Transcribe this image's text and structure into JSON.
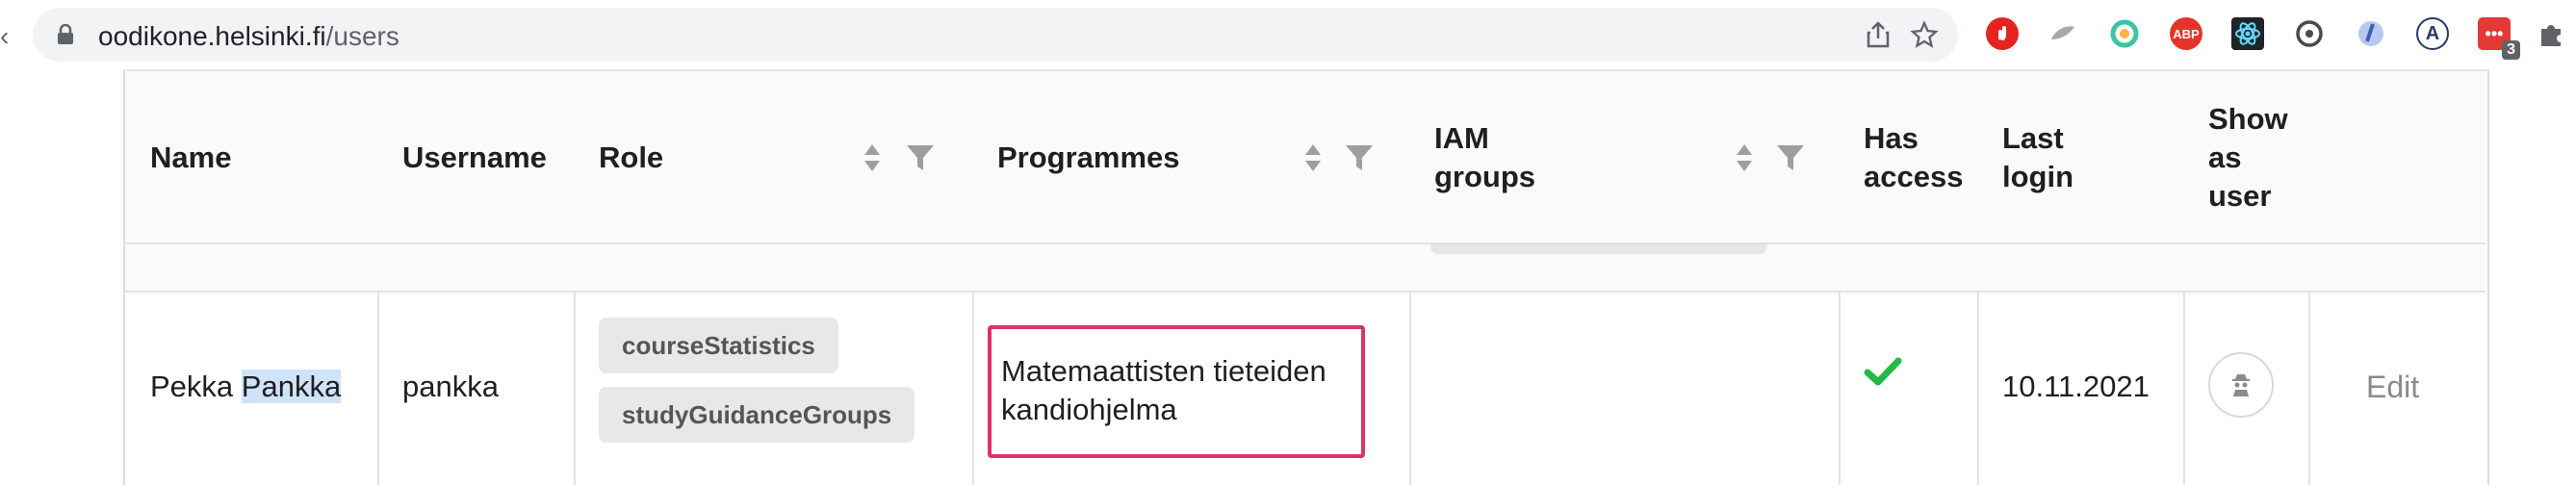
{
  "browser": {
    "url_host": "oodikone.helsinki.fi",
    "url_path": "/users",
    "extensions_badge": "3",
    "extensions": [
      "stop-icon",
      "feather-icon",
      "color-ring-icon",
      "adblock-plus-icon",
      "react-icon",
      "refresh-circle-icon",
      "droplet-icon",
      "accessibility-a-icon",
      "chat-icon",
      "puzzle-icon"
    ],
    "abp_label": "ABP"
  },
  "table": {
    "headers": {
      "name": "Name",
      "username": "Username",
      "role": "Role",
      "programmes": "Programmes",
      "iam_line1": "IAM",
      "iam_line2": "groups",
      "has_access_line1": "Has",
      "has_access_line2": "access",
      "last_login_line1": "Last",
      "last_login_line2": "login",
      "show_as_user_line1": "Show",
      "show_as_user_line2": "as",
      "show_as_user_line3": "user"
    },
    "row": {
      "name_first": "Pekka",
      "name_last": "Pankka",
      "username": "pankka",
      "roles": [
        "courseStatistics",
        "studyGuidanceGroups"
      ],
      "programme": "Matemaattisten tieteiden kandiohjelma",
      "has_access": true,
      "last_login": "10.11.2021",
      "edit_label": "Edit"
    }
  },
  "colors": {
    "highlight_box": "#e0306a",
    "check": "#21ba45",
    "header_bg": "#f9fafb",
    "chip_bg": "#e8e8e8"
  }
}
